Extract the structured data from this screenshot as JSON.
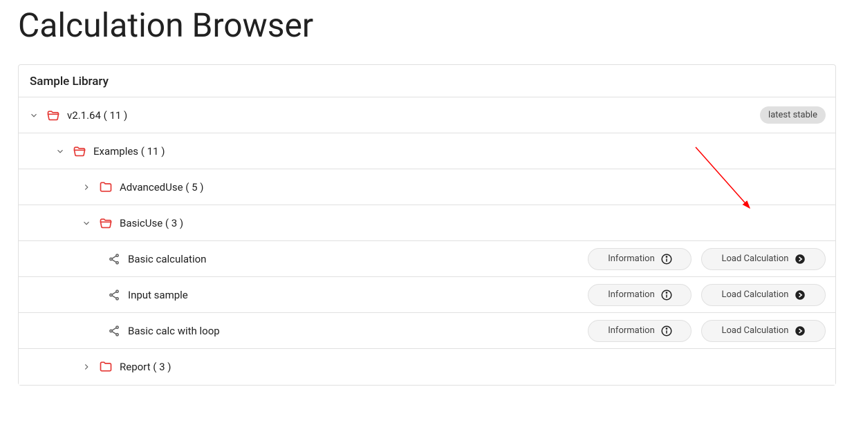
{
  "header": {
    "title": "Calculation Browser"
  },
  "panel": {
    "title": "Sample Library"
  },
  "tree": {
    "root": {
      "label": "v2.1.64 ( 11 )",
      "tag": "latest stable",
      "children": {
        "examples": {
          "label": "Examples ( 11 )",
          "children": {
            "advanced": {
              "label": "AdvancedUse ( 5 )"
            },
            "basic": {
              "label": "BasicUse ( 3 )",
              "items": [
                {
                  "label": "Basic calculation"
                },
                {
                  "label": "Input sample"
                },
                {
                  "label": "Basic calc with loop"
                }
              ]
            },
            "report": {
              "label": "Report ( 3 )"
            }
          }
        }
      }
    }
  },
  "buttons": {
    "information": "Information",
    "load": "Load Calculation"
  },
  "colors": {
    "folder": "#e53935",
    "tag_bg": "#e0e0e0",
    "btn_icon_circle": "#212121"
  }
}
